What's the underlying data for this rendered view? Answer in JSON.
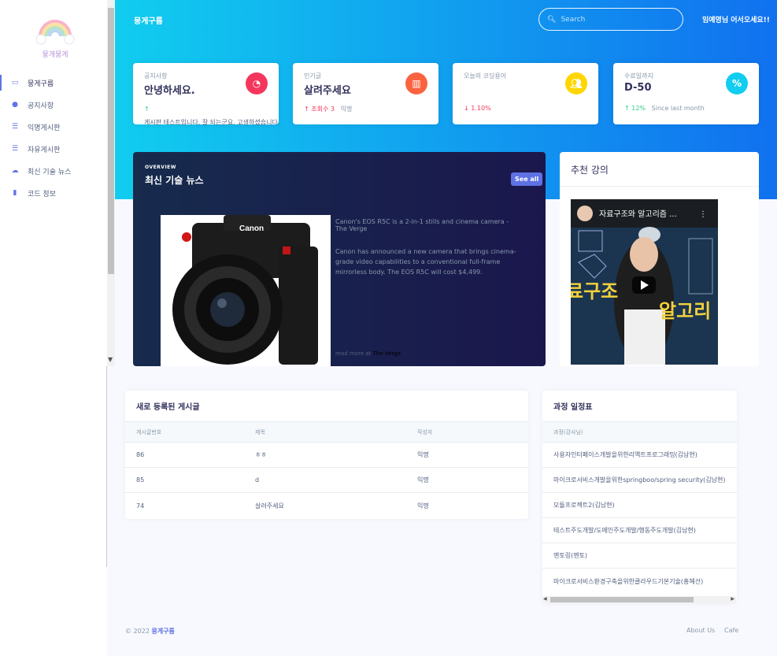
{
  "brand": "뭉게구름",
  "logo_text": "뭉개뭉게",
  "search": {
    "placeholder": "Search"
  },
  "welcome": "임예영님 어서오세요!!",
  "sidebar": {
    "items": [
      {
        "label": "뭉게구름",
        "icon": "tv-icon",
        "active": true
      },
      {
        "label": "공지사항",
        "icon": "pin-icon"
      },
      {
        "label": "익명게시판",
        "icon": "list-icon"
      },
      {
        "label": "자유게시판",
        "icon": "list-icon"
      },
      {
        "label": "최신 기술 뉴스",
        "icon": "cloud-upload-icon"
      },
      {
        "label": "코드 정보",
        "icon": "book-icon"
      }
    ]
  },
  "stats": [
    {
      "label": "공지사항",
      "value": "안녕하세요.",
      "icon": "pie-chart-icon",
      "color": "#f5365c",
      "foot_arrow": "↑",
      "foot_text": "게시판 테스트입니다. 잘 되는군요. 고생하셨습니다.",
      "foot_extra": ""
    },
    {
      "label": "인기글",
      "value": "살려주세요",
      "icon": "bar-chart-icon",
      "color": "#fb6340",
      "foot_arrow": "↑",
      "foot_text": "조회수 3",
      "foot_extra": "익명"
    },
    {
      "label": "오늘의 코딩용어",
      "value": "",
      "icon": "users-icon",
      "color": "#ffd600",
      "foot_arrow": "↓",
      "foot_text": "1.10%",
      "foot_extra": ""
    },
    {
      "label": "수료일까지",
      "value": "D-50",
      "icon": "percent-icon",
      "color": "#11cdef",
      "foot_arrow": "↑",
      "foot_text": "12%",
      "foot_extra": "Since last month"
    }
  ],
  "news": {
    "overview": "OVERVIEW",
    "title": "최신 기술 뉴스",
    "see_all": "See all",
    "headline": "Canon's EOS R5C is a 2-in-1 stills and cinema camera - The Verge",
    "description": "Canon has announced a new camera that brings cinema-grade video capabilities to a conventional full-frame mirrorless body. The EOS R5C will cost $4,499.",
    "read_more": "read more at",
    "source": "The Verge"
  },
  "recommended": {
    "title": "추천 강의",
    "video_title": "자료구조와 알고리즘 ..."
  },
  "posts": {
    "title": "새로 등록된 게시글",
    "columns": [
      "게시글번호",
      "제목",
      "작성자"
    ],
    "rows": [
      [
        "86",
        "ㅎㅎ",
        "익명"
      ],
      [
        "85",
        "d",
        "익명"
      ],
      [
        "74",
        "살려주세요",
        "익명"
      ]
    ]
  },
  "schedule": {
    "title": "과정 일정표",
    "column": "과정(강사님)",
    "rows": [
      "사용자인터페이스개발을위한리액트프로그래밍(김남현)",
      "마이크로서비스개발을위한springboo/spring security(김남현)",
      "모듈프로젝트2(김남현)",
      "테스트주도개발/도메인주도개발/행동주도개발(김남현)",
      "멘토링(멘토)",
      "마이크로서비스환경구축을위한클라우드기본기술(홍혜선)"
    ]
  },
  "footer": {
    "copyright": "© 2022",
    "brand": "뭉게구름",
    "links": [
      "About Us",
      "Cafe"
    ]
  }
}
